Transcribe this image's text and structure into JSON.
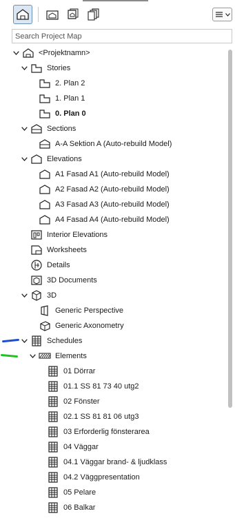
{
  "toolbar": {
    "buttons": [
      {
        "name": "project-map-icon"
      },
      {
        "name": "view-map-icon"
      },
      {
        "name": "layout-book-icon"
      },
      {
        "name": "publisher-sets-icon"
      }
    ],
    "menu_icon": "list-menu-icon"
  },
  "search": {
    "placeholder": "Search Project Map",
    "value": ""
  },
  "tree": [
    {
      "label": "<Projektnamn>",
      "depth": 0,
      "expanded": true,
      "icon": "project-icon"
    },
    {
      "label": "Stories",
      "depth": 1,
      "expanded": true,
      "icon": "stories-icon"
    },
    {
      "label": "2. Plan 2",
      "depth": 2,
      "icon": "story-icon"
    },
    {
      "label": "1. Plan 1",
      "depth": 2,
      "icon": "story-icon"
    },
    {
      "label": "0. Plan 0",
      "depth": 2,
      "icon": "story-icon",
      "bold": true
    },
    {
      "label": "Sections",
      "depth": 1,
      "expanded": true,
      "icon": "sections-icon"
    },
    {
      "label": "A-A Sektion A (Auto-rebuild Model)",
      "depth": 2,
      "icon": "section-icon"
    },
    {
      "label": "Elevations",
      "depth": 1,
      "expanded": true,
      "icon": "elevations-icon"
    },
    {
      "label": "A1 Fasad A1 (Auto-rebuild Model)",
      "depth": 2,
      "icon": "elevation-icon"
    },
    {
      "label": "A2 Fasad A2 (Auto-rebuild Model)",
      "depth": 2,
      "icon": "elevation-icon"
    },
    {
      "label": "A3 Fasad A3 (Auto-rebuild Model)",
      "depth": 2,
      "icon": "elevation-icon"
    },
    {
      "label": "A4 Fasad A4 (Auto-rebuild Model)",
      "depth": 2,
      "icon": "elevation-icon"
    },
    {
      "label": "Interior Elevations",
      "depth": 1,
      "icon": "interior-elevation-icon"
    },
    {
      "label": "Worksheets",
      "depth": 1,
      "icon": "worksheet-icon"
    },
    {
      "label": "Details",
      "depth": 1,
      "icon": "details-icon"
    },
    {
      "label": "3D Documents",
      "depth": 1,
      "icon": "3d-documents-icon"
    },
    {
      "label": "3D",
      "depth": 1,
      "expanded": true,
      "icon": "3d-icon"
    },
    {
      "label": "Generic Perspective",
      "depth": 2,
      "icon": "perspective-icon"
    },
    {
      "label": "Generic Axonometry",
      "depth": 2,
      "icon": "axonometry-icon"
    },
    {
      "label": "Schedules",
      "depth": 1,
      "expanded": true,
      "icon": "schedules-icon"
    },
    {
      "label": "Elements",
      "depth": 2,
      "expanded": true,
      "icon": "elements-icon"
    },
    {
      "label": "01 Dörrar",
      "depth": 3,
      "icon": "schedule-icon"
    },
    {
      "label": "01.1 SS 81 73 40 utg2",
      "depth": 3,
      "icon": "schedule-icon"
    },
    {
      "label": "02 Fönster",
      "depth": 3,
      "icon": "schedule-icon"
    },
    {
      "label": "02.1 SS 81 81 06 utg3",
      "depth": 3,
      "icon": "schedule-icon"
    },
    {
      "label": "03 Erforderlig fönsterarea",
      "depth": 3,
      "icon": "schedule-icon"
    },
    {
      "label": "04 Väggar",
      "depth": 3,
      "icon": "schedule-icon"
    },
    {
      "label": "04.1 Väggar brand- & ljudklass",
      "depth": 3,
      "icon": "schedule-icon"
    },
    {
      "label": "04.2 Väggpresentation",
      "depth": 3,
      "icon": "schedule-icon"
    },
    {
      "label": "05 Pelare",
      "depth": 3,
      "icon": "schedule-icon"
    },
    {
      "label": "06 Balkar",
      "depth": 3,
      "icon": "schedule-icon"
    }
  ],
  "annotations": {
    "blue_mark_color": "#1f4fd1",
    "green_mark_color": "#22c11e"
  },
  "colors": {
    "active_button_bg": "#dbe6f3",
    "scroll_thumb": "#c1c1c1"
  }
}
